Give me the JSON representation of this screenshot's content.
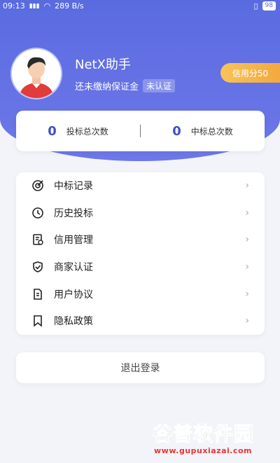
{
  "status_bar": {
    "time": "09:13",
    "signal": "4G",
    "speed": "289 B/s",
    "battery": "98"
  },
  "profile": {
    "name": "NetX助手",
    "deposit_text": "还未缴纳保证金",
    "auth_status": "未认证",
    "credit_label": "信用分50"
  },
  "stats": [
    {
      "value": "0",
      "label": "投标总次数"
    },
    {
      "value": "0",
      "label": "中标总次数"
    }
  ],
  "menu": [
    {
      "label": "中标记录",
      "icon": "target-icon"
    },
    {
      "label": "历史投标",
      "icon": "clock-icon"
    },
    {
      "label": "信用管理",
      "icon": "credit-doc-icon"
    },
    {
      "label": "商家认证",
      "icon": "shield-check-icon"
    },
    {
      "label": "用户协议",
      "icon": "document-icon"
    },
    {
      "label": "隐私政策",
      "icon": "bookmark-icon"
    }
  ],
  "logout_label": "退出登录",
  "watermark": {
    "title": "谷普软件园",
    "url": "www.gupuxiazai.com"
  },
  "colors": {
    "primary": "#5a6be0",
    "accent": "#f3a93e",
    "number": "#3f4fc9"
  }
}
